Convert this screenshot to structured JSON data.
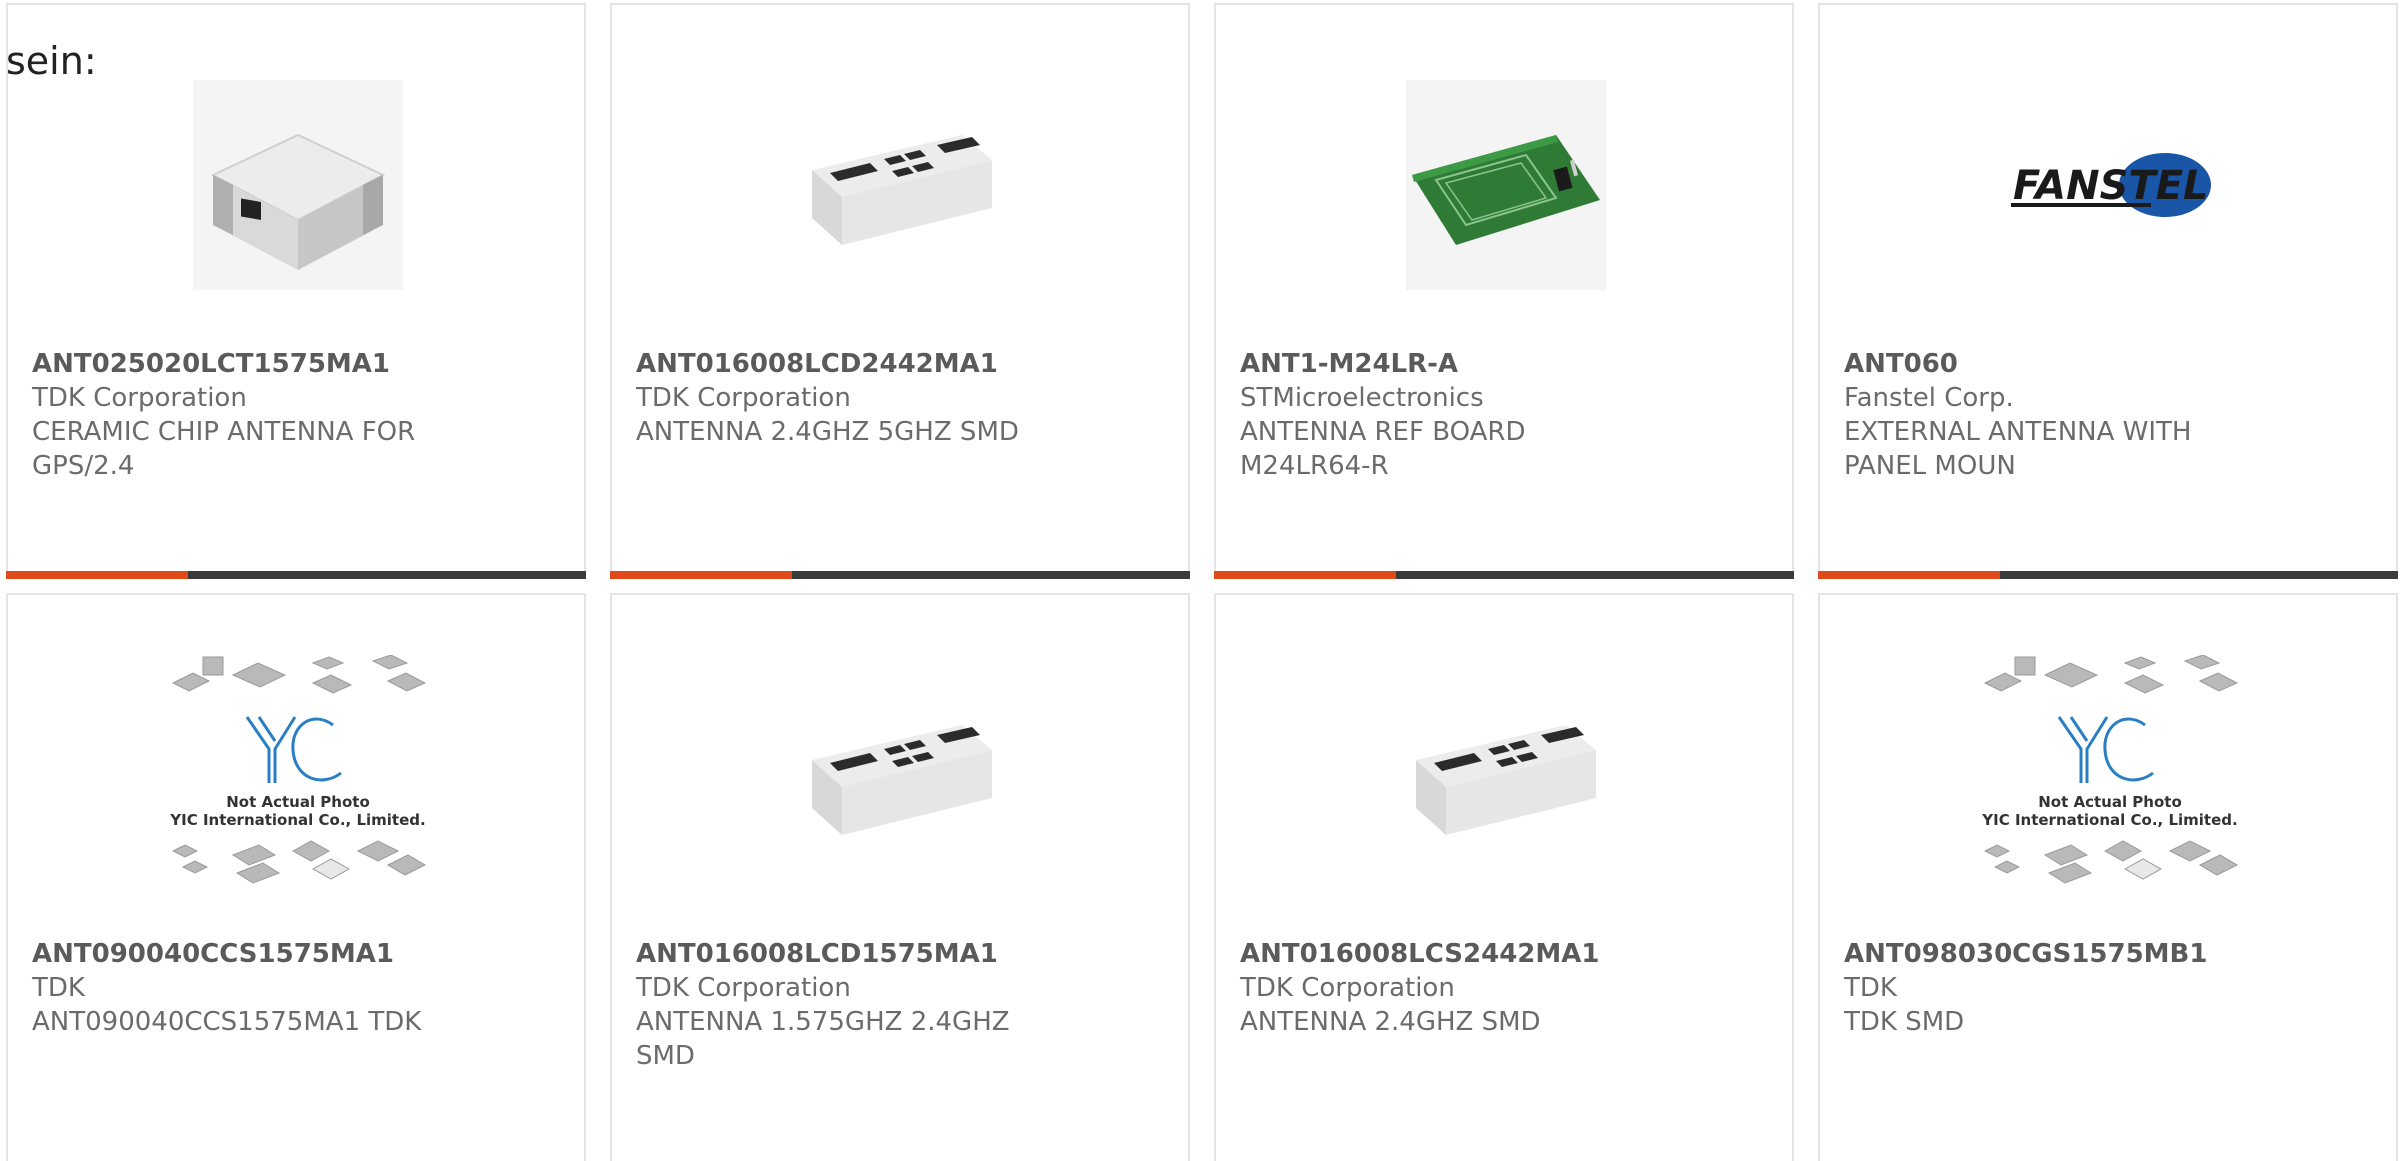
{
  "lead_text": "sein:",
  "colors": {
    "card_border": "#e4e4e4",
    "bar_dark": "#3b3b3b",
    "bar_accent": "#e04a1a",
    "text_gray": "#6b6b6b"
  },
  "products": [
    {
      "part_number": "ANT025020LCT1575MA1",
      "manufacturer": "TDK Corporation",
      "description": "CERAMIC CHIP ANTENNA FOR GPS/2.4",
      "image": "ceramic-chip-antenna-image"
    },
    {
      "part_number": "ANT016008LCD2442MA1",
      "manufacturer": "TDK Corporation",
      "description": "ANTENNA 2.4GHZ 5GHZ SMD",
      "image": "smd-chip-antenna-image"
    },
    {
      "part_number": "ANT1-M24LR-A",
      "manufacturer": "STMicroelectronics",
      "description": "ANTENNA REF BOARD M24LR64-R",
      "image": "antenna-ref-board-image"
    },
    {
      "part_number": "ANT060",
      "manufacturer": "Fanstel Corp.",
      "description": "EXTERNAL ANTENNA WITH PANEL MOUN",
      "image": "fanstel-logo-image",
      "logo_text": "FANSTEL"
    },
    {
      "part_number": "ANT090040CCS1575MA1",
      "manufacturer": "TDK",
      "description": "ANT090040CCS1575MA1 TDK",
      "image": "yic-placeholder-image",
      "placeholder_line1": "Not Actual Photo",
      "placeholder_line2": "YIC International Co., Limited."
    },
    {
      "part_number": "ANT016008LCD1575MA1",
      "manufacturer": "TDK Corporation",
      "description": "ANTENNA 1.575GHZ 2.4GHZ SMD",
      "image": "smd-chip-antenna-image"
    },
    {
      "part_number": "ANT016008LCS2442MA1",
      "manufacturer": "TDK Corporation",
      "description": "ANTENNA 2.4GHZ SMD",
      "image": "smd-chip-antenna-image"
    },
    {
      "part_number": "ANT098030CGS1575MB1",
      "manufacturer": "TDK",
      "description": "TDK SMD",
      "image": "yic-placeholder-image",
      "placeholder_line1": "Not Actual Photo",
      "placeholder_line2": "YIC International Co., Limited."
    }
  ]
}
